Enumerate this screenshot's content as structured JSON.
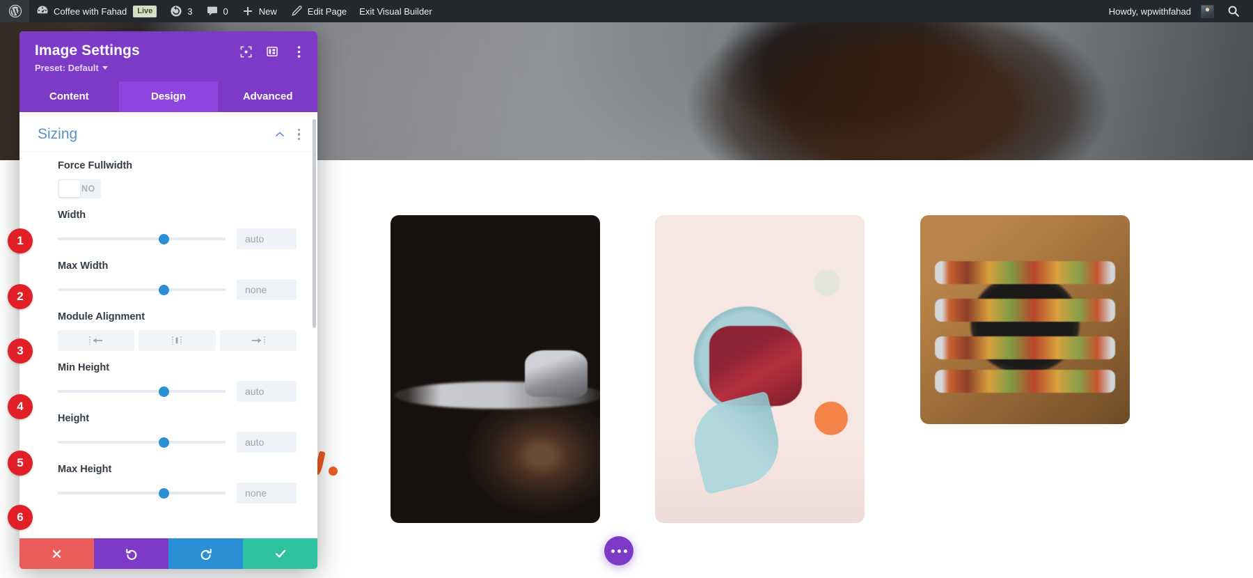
{
  "adminbar": {
    "logo_icon": "wordpress-logo-icon",
    "site_icon": "dashboard-icon",
    "site_name": "Coffee with Fahad",
    "live_badge": "Live",
    "updates_icon": "updates-icon",
    "updates_count": "3",
    "comments_icon": "comments-icon",
    "comments_count": "0",
    "new_icon": "plus-icon",
    "new_label": "New",
    "edit_icon": "pencil-icon",
    "edit_label": "Edit Page",
    "exit_label": "Exit Visual Builder",
    "howdy": "Howdy, wpwithfahad",
    "avatar": "user-avatar",
    "search_icon": "search-icon"
  },
  "modal": {
    "title": "Image Settings",
    "preset_label": "Preset: Default",
    "header_icons": [
      {
        "name": "expand-view-icon"
      },
      {
        "name": "layout-columns-icon"
      },
      {
        "name": "more-options-icon"
      }
    ],
    "tabs": [
      {
        "label": "Content",
        "active": false
      },
      {
        "label": "Design",
        "active": true
      },
      {
        "label": "Advanced",
        "active": false
      }
    ],
    "group": {
      "title": "Sizing",
      "collapse_icon": "chevron-up-icon",
      "menu_icon": "kebab-menu-icon"
    },
    "fields": {
      "force_fullwidth": {
        "label": "Force Fullwidth",
        "toggle_value": "NO"
      },
      "width": {
        "label": "Width",
        "value": "",
        "placeholder": "auto",
        "slider_pct": 60,
        "marker": "1"
      },
      "max_width": {
        "label": "Max Width",
        "value": "",
        "placeholder": "none",
        "slider_pct": 60,
        "marker": "2"
      },
      "module_alignment": {
        "label": "Module Alignment",
        "marker": "3",
        "options": [
          {
            "name": "align-left-icon",
            "label": "Left"
          },
          {
            "name": "align-center-icon",
            "label": "Center"
          },
          {
            "name": "align-right-icon",
            "label": "Right"
          }
        ]
      },
      "min_height": {
        "label": "Min Height",
        "value": "",
        "placeholder": "auto",
        "slider_pct": 60,
        "marker": "4"
      },
      "height": {
        "label": "Height",
        "value": "",
        "placeholder": "auto",
        "slider_pct": 60,
        "marker": "5"
      },
      "max_height": {
        "label": "Max Height",
        "value": "",
        "placeholder": "none",
        "slider_pct": 60,
        "marker": "6"
      }
    },
    "footer": [
      {
        "name": "cancel-button",
        "icon": "close-icon",
        "color": "#eb5d5b"
      },
      {
        "name": "undo-button",
        "icon": "undo-icon",
        "color": "#7d3ac7"
      },
      {
        "name": "redo-button",
        "icon": "redo-icon",
        "color": "#2a8fd4"
      },
      {
        "name": "save-button",
        "icon": "checkmark-icon",
        "color": "#2ec2a0"
      }
    ]
  },
  "page": {
    "gallery": [
      {
        "name": "image-coffee-grinder"
      },
      {
        "name": "image-jam-toast"
      },
      {
        "name": "image-skewers-pan"
      }
    ],
    "fab_icon": "more-horizontal-icon"
  },
  "colors": {
    "divi_purple": "#7d3ac7",
    "divi_purple_active": "#8e45e0",
    "group_title_blue": "#5b8ec9",
    "slider_knob_blue": "#2a8fd4",
    "marker_red": "#e01f26",
    "adminbar_dark": "#23282d",
    "accent_orange": "#ee5b23"
  }
}
